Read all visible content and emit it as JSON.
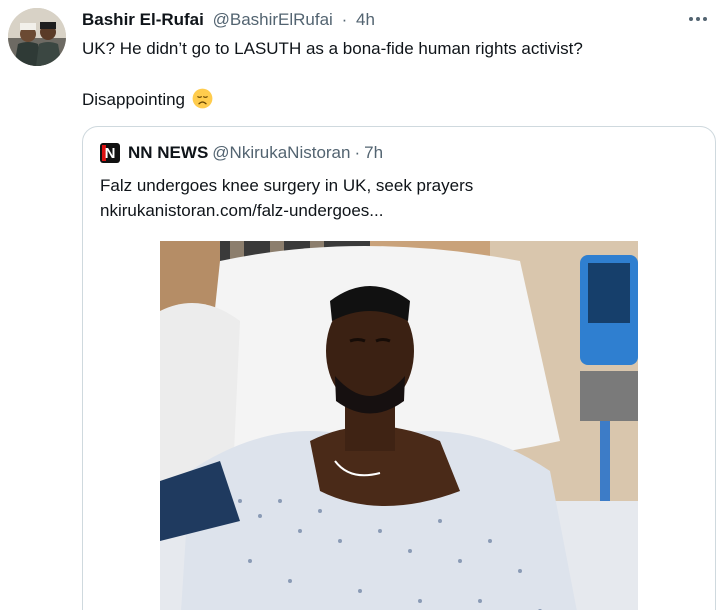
{
  "tweet": {
    "author_name": "Bashir El-Rufai",
    "author_handle": "@BashirElRufai",
    "separator": "·",
    "time": "4h",
    "text_line1": "UK? He didn’t go to LASUTH as a bona-fide human rights activist?",
    "text_line2": "Disappointing",
    "emoji_icon": "disappointed-face-emoji"
  },
  "quoted": {
    "logo_letter": "N",
    "author_name": "NN NEWS",
    "author_handle": "@NkirukaNistoran",
    "separator": "·",
    "time": "7h",
    "text": "Falz undergoes knee surgery in UK, seek prayers",
    "link": "nkirukanistoran.com/falz-undergoes..."
  },
  "colors": {
    "text_primary": "#0f1419",
    "text_secondary": "#536471",
    "border": "#cfd9de"
  }
}
